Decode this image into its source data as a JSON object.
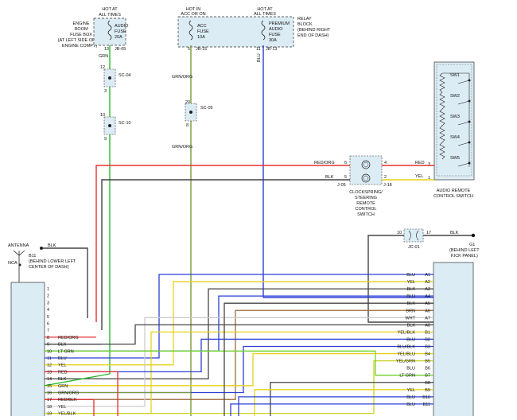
{
  "header": {
    "engine_box": {
      "hot": [
        "HOT AT",
        "ALL TIMES"
      ],
      "location": [
        "ENGINE",
        "ROOM",
        "FUSE BOX",
        "(AT LEFT SIDE OF",
        "ENGINE COMPT)"
      ],
      "fuse": [
        "AUDIO",
        "FUSE",
        "20A"
      ],
      "pin": "13",
      "conn": "JB-05"
    },
    "acc_box": {
      "hot": [
        "HOT IN",
        "ACC OR ON"
      ],
      "fuse": [
        "ACC",
        "FUSE",
        "10A"
      ],
      "pin": "5",
      "conn": "JB-15"
    },
    "premium_box": {
      "hot": [
        "HOT AT",
        "ALL TIMES"
      ],
      "fuse": [
        "PREMIUM",
        "AUDIO",
        "FUSE",
        "30A"
      ],
      "pin": "11",
      "conn": "JB-13"
    },
    "relay_block": [
      "RELAY",
      "BLOCK",
      "(BEHIND RIGHT",
      "END OF DASH)"
    ]
  },
  "left_wires": {
    "grn": "GRN",
    "sc04": "SC-04",
    "sc04_pins": [
      "12",
      "3"
    ],
    "sc10": "SC-10",
    "sc10_pins": [
      "10",
      "9"
    ],
    "grn_org": "GRN/ORG",
    "sc05": "SC-05",
    "sc05_pins": [
      "20",
      "8"
    ],
    "blu": "BLU"
  },
  "sw_switch": {
    "switches": [
      "SW1",
      "SW2",
      "SW3",
      "SW4",
      "SW5"
    ],
    "pins": [
      "3",
      "1"
    ],
    "wires": [
      "RED",
      "YEL"
    ],
    "label": [
      "AUDIO REMOTE",
      "CONTROL SWITCH"
    ]
  },
  "clockspring": {
    "in_wires": [
      "RED/ORG",
      "BLK"
    ],
    "in_pins": [
      "6",
      "5"
    ],
    "out_pins": [
      "4",
      "2"
    ],
    "conn_left": "J-05",
    "conn_right": "J-18",
    "label": [
      "CLOCKSPRING/",
      "STEERING",
      "REMOTE",
      "CONTROL",
      "SWITCH"
    ]
  },
  "ground": {
    "pin_left": "10",
    "pin_right": "17",
    "conn": "JC-01",
    "wire": "BLK",
    "id": "G1",
    "location": [
      "(BEHIND LEFT",
      "KICK PANEL)"
    ]
  },
  "antenna": {
    "label": "ANTENNA",
    "wire": "BLK",
    "nca": "NCA",
    "id": "B11",
    "location": [
      "(BEHIND LOWER LEFT",
      "CENTER OF DASH)"
    ]
  },
  "left_connector": {
    "pins": [
      "1",
      "2",
      "3",
      "4",
      "5",
      "6",
      "7",
      "8",
      "9",
      "10",
      "11",
      "12",
      "13",
      "14",
      "15",
      "16",
      "17",
      "18",
      "19"
    ],
    "wires": [
      "",
      "",
      "",
      "",
      "",
      "",
      "",
      "RED/ORG",
      "BLK",
      "LT GRN",
      "BLU",
      "YEL",
      "RED",
      "BLK",
      "GRN",
      "GRN/ORG",
      "RED/BLK",
      "YEL",
      "YEL/BLK"
    ]
  },
  "right_connector": {
    "pins": [
      "A1",
      "A2",
      "A3",
      "A4",
      "A5",
      "A6",
      "A7",
      "A8",
      "B1",
      "B2",
      "B3",
      "B4",
      "B5",
      "B6",
      "B7",
      "B8",
      "B9",
      "B10",
      "B11"
    ],
    "wires": [
      "BLU",
      "YEL",
      "BLK",
      "BLU",
      "BLK",
      "BRN",
      "WHT",
      "BLK",
      "YEL/BLK",
      "BLU",
      "BLU/BLK",
      "YEL/BLU",
      "YEL/GRN",
      "BLU",
      "LT GRN",
      "",
      "YEL",
      "BLU",
      "BLU"
    ]
  }
}
